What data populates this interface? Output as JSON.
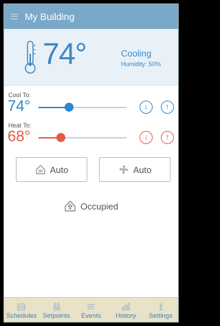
{
  "app": {
    "title": "My Building"
  },
  "status": {
    "current_temp": "74°",
    "mode": "Cooling",
    "humidity": "Humidity: 50%"
  },
  "cool": {
    "label": "Cool To:",
    "value": "74°",
    "level": 0.35
  },
  "heat": {
    "label": "Heat To:",
    "value": "68°",
    "level": 0.25
  },
  "buttons": {
    "system_mode": "Auto",
    "fan_mode": "Auto"
  },
  "occupancy": {
    "label": "Occupied"
  },
  "tabs": [
    {
      "label": "Schedules",
      "icon": "calendar-icon"
    },
    {
      "label": "Setpoints",
      "icon": "setpoints-icon"
    },
    {
      "label": "Events",
      "icon": "list-icon"
    },
    {
      "label": "History",
      "icon": "bar-chart-icon"
    },
    {
      "label": "Settings",
      "icon": "wrench-icon"
    }
  ],
  "colors": {
    "titlebar": "#7ba7c8",
    "cool": "#2a87d0",
    "heat": "#e45a44",
    "tab_bar": "#e8e2c8"
  }
}
